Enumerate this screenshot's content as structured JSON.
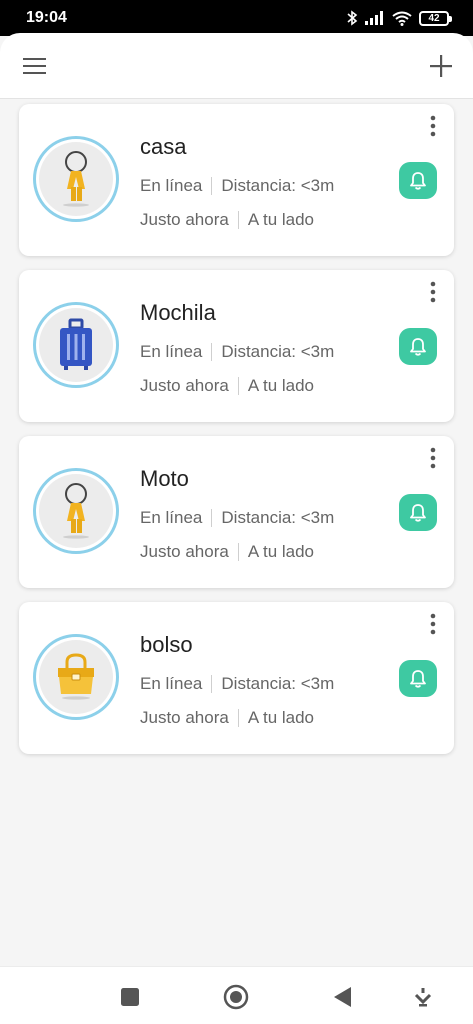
{
  "status_bar": {
    "time": "19:04",
    "battery": "42",
    "icons": [
      "bluetooth-icon",
      "signal-icon",
      "wifi-icon",
      "battery-icon"
    ]
  },
  "app_bar": {
    "menu_icon": "hamburger-menu-icon",
    "add_icon": "plus-icon"
  },
  "colors": {
    "accent": "#3ec9a2",
    "avatar_ring": "#8cd0ea",
    "background": "#f5f5f5",
    "card": "#ffffff"
  },
  "devices": [
    {
      "name": "casa",
      "status": "En línea",
      "distance": "Distancia: <3m",
      "time": "Justo ahora",
      "location": "A tu lado",
      "icon": "keys-icon"
    },
    {
      "name": "Mochila",
      "status": "En línea",
      "distance": "Distancia: <3m",
      "time": "Justo ahora",
      "location": "A tu lado",
      "icon": "suitcase-icon"
    },
    {
      "name": "Moto",
      "status": "En línea",
      "distance": "Distancia: <3m",
      "time": "Justo ahora",
      "location": "A tu lado",
      "icon": "keys-icon"
    },
    {
      "name": "bolso",
      "status": "En línea",
      "distance": "Distancia: <3m",
      "time": "Justo ahora",
      "location": "A tu lado",
      "icon": "handbag-icon"
    }
  ],
  "nav_bar": {
    "icons": [
      "recents-square-icon",
      "home-circle-icon",
      "back-triangle-icon",
      "dropdown-icon"
    ]
  }
}
